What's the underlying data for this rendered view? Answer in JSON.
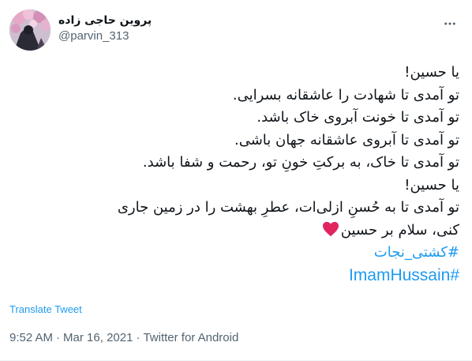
{
  "author": {
    "display_name": "پروین حاجی زاده",
    "handle": "@parvin_313",
    "avatar_icon": "profile-photo-flowers"
  },
  "menu": {
    "icon": "more-horizontal-icon"
  },
  "tweet": {
    "lines": [
      "یا حسین!",
      "تو آمدی تا شهادت را عاشقانه بسرایی.",
      "تو آمدی تا خونت آبروی خاک باشد.",
      "تو آمدی تا آبروی عاشقانه جهان باشی.",
      "تو آمدی تا خاک، به برکتِ خونِ تو، رحمت و شفا باشد.",
      "یا حسین!",
      "تو آمدی تا به حُسنِ ازلی‌ات، عطرِ بهشت را در زمین جاری",
      "کنی، سلام بر حسین"
    ],
    "hashtags": [
      "#کشتی_نجات",
      "#ImamHussain"
    ],
    "heart_icon": "red-heart-icon"
  },
  "translate_label": "Translate Tweet",
  "meta": {
    "time": "9:52 AM",
    "date": "Mar 16, 2021",
    "source": "Twitter for Android",
    "separator": "·"
  },
  "colors": {
    "link": "#1d9bf0",
    "secondary": "#536471",
    "heart": "#e0245e"
  }
}
